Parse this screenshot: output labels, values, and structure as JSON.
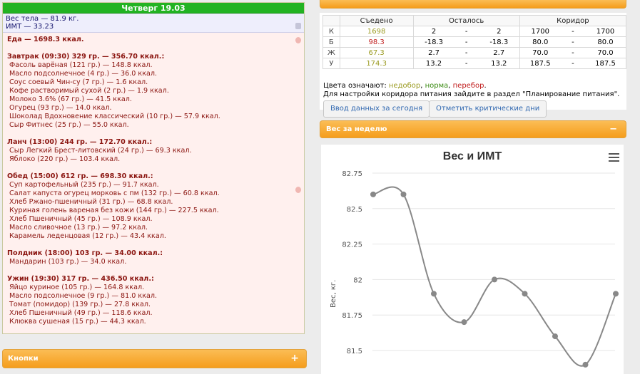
{
  "day": {
    "header": "Четверг 19.03",
    "weight_line": "Вес тела — 81.9 кг.",
    "bmi_line": "ИМТ — 33.23",
    "food_total": "Еда — 1698.3 ккал.",
    "meals": [
      {
        "title": "Завтрак (09:30) 329 гр. — 356.70 ккал.:",
        "items": [
          "Фасоль варёная (121 гр.) — 148.8 ккал.",
          "Масло подсолнечное (4 гр.) — 36.0 ккал.",
          "Соус соевый Чин-су (7 гр.) — 1.6 ккал.",
          "Кофе растворимый сухой (2 гр.) — 1.9 ккал.",
          "Молоко 3.6% (67 гр.) — 41.5 ккал.",
          "Огурец (93 гр.) — 14.0 ккал.",
          "Шоколад Вдохновение классический (10 гр.) — 57.9 ккал.",
          "Сыр Фитнес (25 гр.) — 55.0 ккал."
        ]
      },
      {
        "title": "Ланч (13:00) 244 гр. — 172.70 ккал.:",
        "items": [
          "Сыр Легкий Брест-литовский (24 гр.) — 69.3 ккал.",
          "Яблоко (220 гр.) — 103.4 ккал."
        ]
      },
      {
        "title": "Обед (15:00) 612 гр. — 698.30 ккал.:",
        "items": [
          "Суп картофельный (235 гр.) — 91.7 ккал.",
          "Салат капуста огурец морковь с пм (132 гр.) — 60.8 ккал.",
          "Хлеб Ржано-пшеничный (31 гр.) — 68.8 ккал.",
          "Куриная голень вареная без кожи (144 гр.) — 227.5 ккал.",
          "Хлеб Пшеничный (45 гр.) — 108.9 ккал.",
          "Масло сливочное (13 гр.) — 97.2 ккал.",
          "Карамель леденцовая (12 гр.) — 43.4 ккал."
        ]
      },
      {
        "title": "Полдник (18:00) 103 гр. — 34.00 ккал.:",
        "items": [
          "Мандарин (103 гр.) — 34.0 ккал."
        ]
      },
      {
        "title": "Ужин (19:30) 317 гр. — 436.50 ккал.:",
        "items": [
          "Яйцо куриное (105 гр.) — 164.8 ккал.",
          "Масло подсолнечное (9 гр.) — 81.0 ккал.",
          "Томат (помидор) (139 гр.) — 27.8 ккал.",
          "Хлеб Пшеничный (49 гр.) — 118.6 ккал.",
          "Клюква сушеная (15 гр.) — 44.3 ккал."
        ]
      }
    ]
  },
  "buttons_panel": {
    "title": "Кнопки",
    "toggle": "+"
  },
  "corridor": {
    "toggle": "−",
    "headers": [
      "Съедено",
      "Осталось",
      "Коридор"
    ],
    "rows": [
      {
        "key": "К",
        "eaten": "1698",
        "eaten_color": "#9b9b22",
        "rest_a": "2",
        "rest_b": "2",
        "cor_a": "1700",
        "cor_b": "1700"
      },
      {
        "key": "Б",
        "eaten": "98.3",
        "eaten_color": "#c01c1c",
        "rest_a": "-18.3",
        "rest_b": "-18.3",
        "cor_a": "80.0",
        "cor_b": "80.0"
      },
      {
        "key": "Ж",
        "eaten": "67.3",
        "eaten_color": "#9b9b22",
        "rest_a": "2.7",
        "rest_b": "2.7",
        "cor_a": "70.0",
        "cor_b": "70.0"
      },
      {
        "key": "У",
        "eaten": "174.3",
        "eaten_color": "#9b9b22",
        "rest_a": "13.2",
        "rest_b": "13.2",
        "cor_a": "187.5",
        "cor_b": "187.5"
      }
    ],
    "dash": "-",
    "legend_prefix": "Цвета означают: ",
    "legend_under": "недобор",
    "legend_norm": "норма",
    "legend_over": "перебор",
    "legend_sep": ", ",
    "legend_end": ".",
    "note": "Для настройки коридора питания зайдите в раздел \"Планирование питания\".",
    "btn_enter": "Ввод данных за сегодня",
    "btn_critical": "Отметить критические дни"
  },
  "week": {
    "title": "Вес за неделю",
    "toggle": "−"
  },
  "chart_data": {
    "type": "line",
    "title": "Вес и ИМТ",
    "ylabel": "Вес, кг.",
    "y_ticks": [
      "82.75",
      "82.5",
      "82.25",
      "82",
      "81.75",
      "81.5"
    ],
    "ylim": [
      81.5,
      82.75
    ],
    "series": [
      {
        "values": [
          82.6,
          82.6,
          81.9,
          81.7,
          82.0,
          81.9,
          81.6,
          81.4,
          81.9
        ]
      }
    ],
    "line_color": "#888888",
    "grid": true
  }
}
